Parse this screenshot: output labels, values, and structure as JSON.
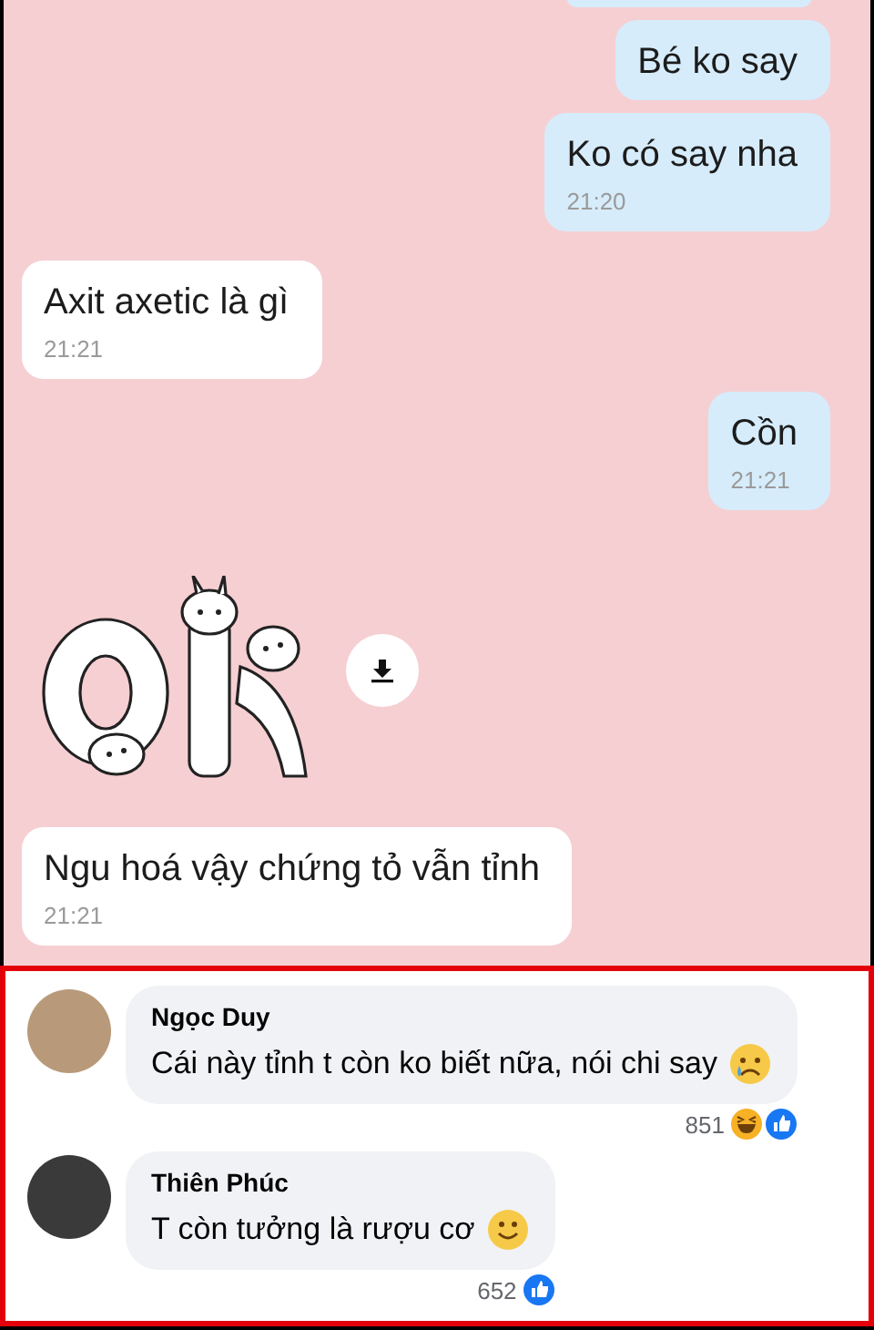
{
  "chat": {
    "messages": [
      {
        "kind": "sent",
        "text": "Bé ko say"
      },
      {
        "kind": "sent",
        "text": "Ko có say nha",
        "time": "21:20"
      },
      {
        "kind": "received",
        "text": "Axit axetic là gì",
        "time": "21:21"
      },
      {
        "kind": "sent",
        "text": "Cồn",
        "time": "21:21"
      },
      {
        "kind": "sticker"
      },
      {
        "kind": "received",
        "text": "Ngu hoá vậy chứng tỏ vẫn tỉnh",
        "time": "21:21"
      }
    ]
  },
  "comments": [
    {
      "name": "Ngọc Duy",
      "text": "Cái này tỉnh t còn ko biết nữa, nói chi say",
      "emoji": {
        "kind": "crying"
      },
      "count": "851",
      "reactions": [
        {
          "kind": "haha"
        },
        {
          "kind": "like"
        }
      ]
    },
    {
      "name": "Thiên Phúc",
      "text": "T còn tưởng là rượu cơ",
      "emoji": {
        "kind": "smile"
      },
      "count": "652",
      "reactions": [
        {
          "kind": "like"
        }
      ]
    }
  ]
}
